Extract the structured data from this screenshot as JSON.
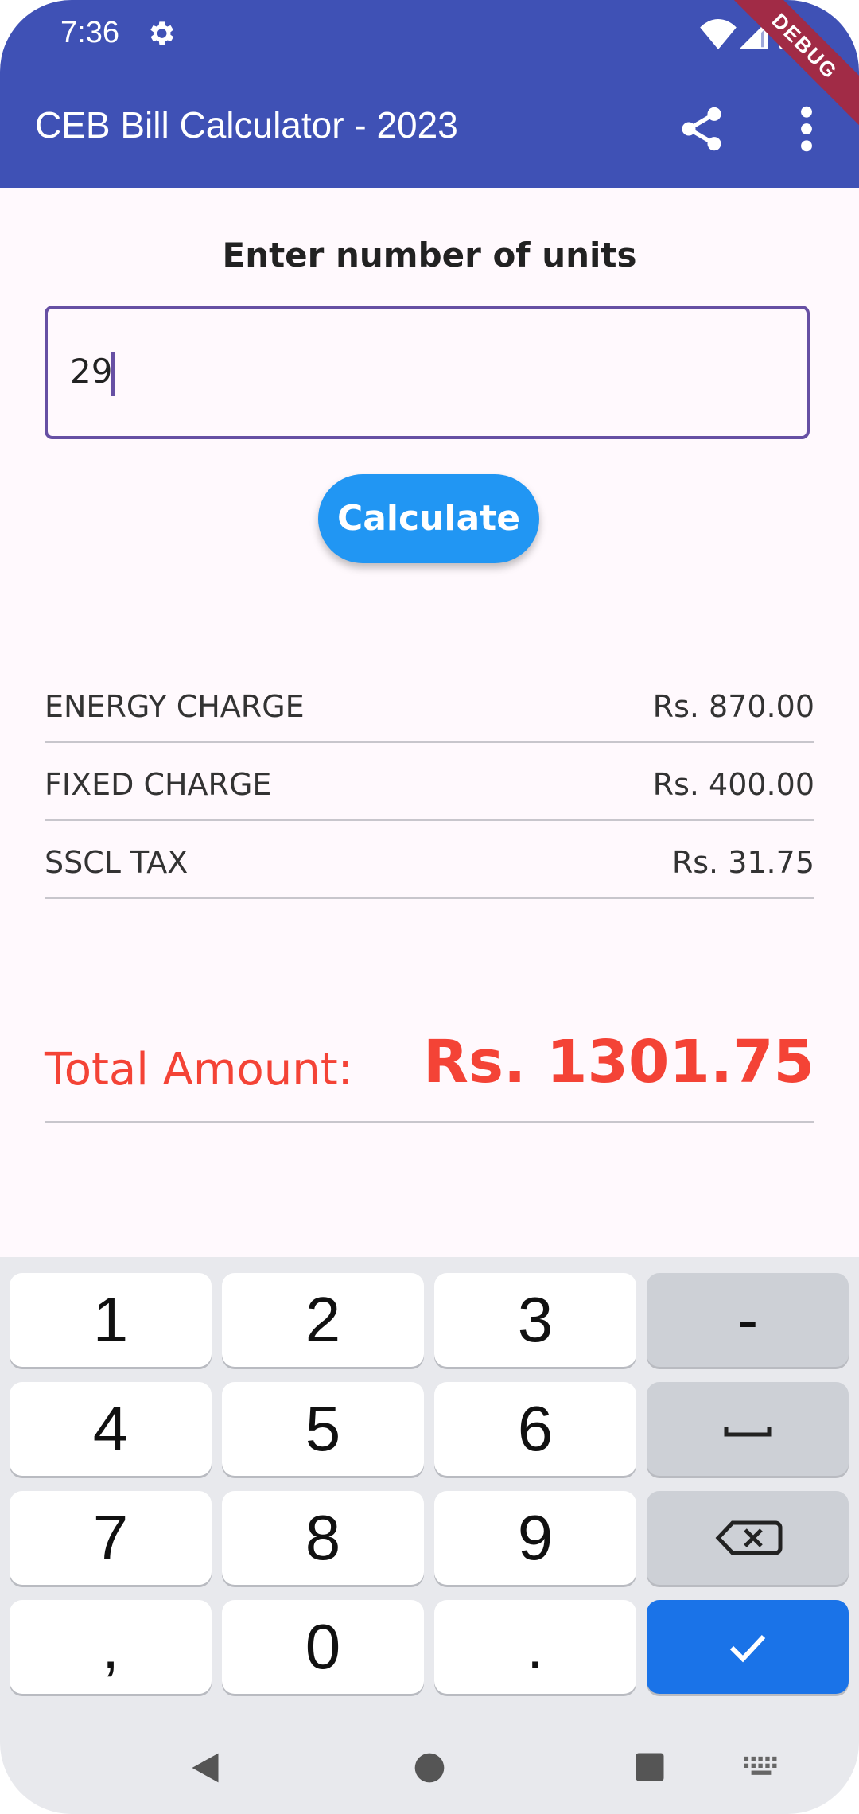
{
  "status_bar": {
    "time": "7:36"
  },
  "debug_banner": "DEBUG",
  "app_bar": {
    "title": "CEB Bill Calculator - 2023"
  },
  "form": {
    "prompt": "Enter number of units",
    "units_value": "29",
    "calculate_label": "Calculate"
  },
  "charges": [
    {
      "label": "ENERGY CHARGE",
      "value": "Rs. 870.00"
    },
    {
      "label": "FIXED CHARGE",
      "value": "Rs. 400.00"
    },
    {
      "label": "SSCL TAX",
      "value": "Rs. 31.75"
    }
  ],
  "total": {
    "label": "Total Amount:",
    "value": "Rs. 1301.75"
  },
  "keyboard": {
    "rows": [
      [
        "1",
        "2",
        "3",
        "-"
      ],
      [
        "4",
        "5",
        "6",
        "space"
      ],
      [
        "7",
        "8",
        "9",
        "backspace"
      ],
      [
        ",",
        "0",
        ".",
        "done"
      ]
    ]
  },
  "colors": {
    "app_bar": "#3f51b5",
    "input_border": "#6750a4",
    "button": "#2196f3",
    "total_text": "#f44336",
    "done_key": "#1a73e8"
  }
}
